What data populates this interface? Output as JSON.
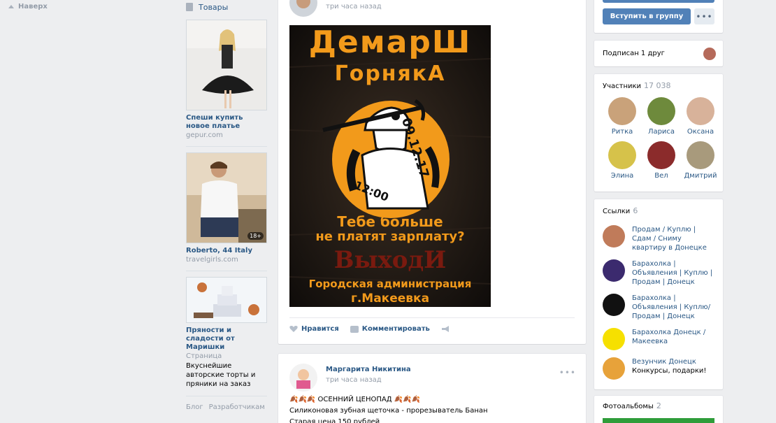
{
  "nav": {
    "back_label": "Наверх"
  },
  "ads": {
    "header": "Товары",
    "items": [
      {
        "title": "Спеши купить новое платье",
        "site": "gepur.com",
        "desc": "",
        "age": ""
      },
      {
        "title": "Roberto, 44 Italy",
        "site": "travelgirls.com",
        "desc": "",
        "age": "18+"
      },
      {
        "title": "Пряности и сладости от Маришки",
        "site": "Страница",
        "desc": "Вкуснейшие авторские торты и пряники на заказ",
        "age": ""
      }
    ],
    "footer": [
      "Блог",
      "Разработчикам"
    ]
  },
  "post1": {
    "time": "три часа назад",
    "poster": {
      "line1": "ДемарШ",
      "line2": "ГорнякА",
      "date": "09.12.17",
      "hour": "12:00",
      "q1": "Тебе больше",
      "q2": "не платят зарплату?",
      "call": "ВыходИ",
      "place1": "Городская администрация",
      "place2": "г.Макеевка"
    },
    "like_label": "Нравится",
    "comment_label": "Комментировать"
  },
  "post2": {
    "author": "Маргарита Никитина",
    "time": "три часа назад",
    "line1": "🍂🍂🍂 ОСЕННИЙ ЦЕНОПАД 🍂🍂🍂",
    "line2": "Силиконовая зубная щеточка - прорезыватель Банан",
    "line3": "Старая цена 150 рублей"
  },
  "group": {
    "join_label": "Вступить в группу",
    "more_label": "•••",
    "friends_label": "Подписан 1 друг",
    "members_title": "Участники",
    "members_count": "17 038",
    "members": [
      {
        "name": "Ритка",
        "color": "#c9a27a"
      },
      {
        "name": "Лариса",
        "color": "#6e8a3c"
      },
      {
        "name": "Оксана",
        "color": "#d8b29a"
      },
      {
        "name": "Элина",
        "color": "#d6c24a"
      },
      {
        "name": "Вел",
        "color": "#8b2b2b"
      },
      {
        "name": "Дмитрий",
        "color": "#a89a7c"
      }
    ],
    "links_title": "Ссылки",
    "links_count": "6",
    "links": [
      {
        "title": "Продам / Куплю | Сдам / Сниму квартиру в Донецке",
        "sub": "",
        "color": "#c07b5a"
      },
      {
        "title": "Барахолка | Объявления | Куплю | Продам | Донецк",
        "sub": "",
        "color": "#3b2a6e"
      },
      {
        "title": "Барахолка | Объявления | Куплю/Продам | Донецк",
        "sub": "",
        "color": "#111111"
      },
      {
        "title": "Барахолка Донецк / Макеевка",
        "sub": "",
        "color": "#f6e000"
      },
      {
        "title": "Везунчик Донецк",
        "sub": "Конкурсы, подарки!",
        "color": "#e7a23a"
      }
    ],
    "albums_title": "Фотоальбомы",
    "albums_count": "2"
  }
}
